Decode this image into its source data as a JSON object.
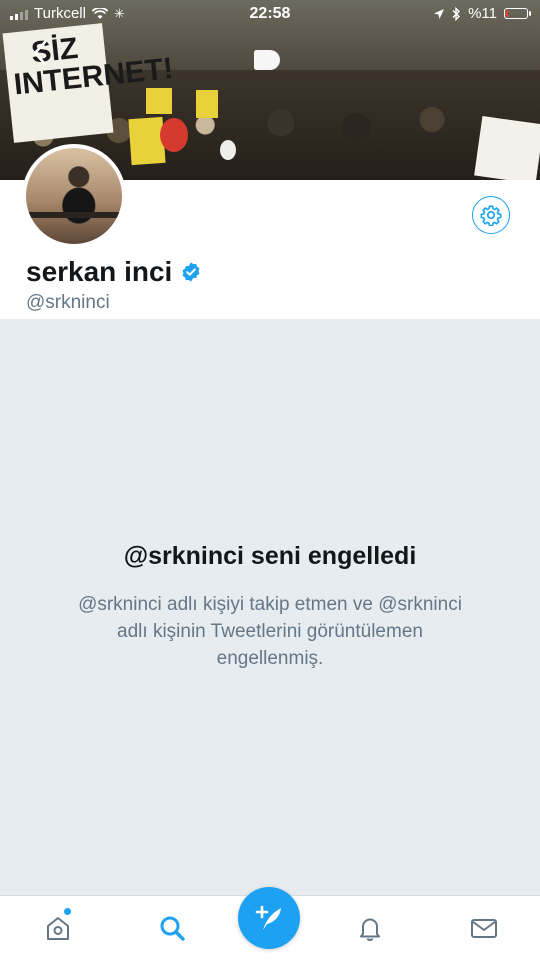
{
  "status_bar": {
    "carrier": "Turkcell",
    "time": "22:58",
    "battery": "%11",
    "battery_level": 0.11
  },
  "banner": {
    "sign_text": "SİZ INTERNET!"
  },
  "profile": {
    "name": "serkan inci",
    "handle": "@srkninci",
    "verified": true
  },
  "blocked": {
    "title": "@srkninci seni engelledi",
    "description": "@srkninci adlı kişiyi takip etmen ve @srkninci adlı kişinin Tweetlerini görüntülemen engellenmiş."
  },
  "tabs": [
    {
      "icon": "home-icon",
      "has_notification_dot": true
    },
    {
      "icon": "search-icon",
      "active": true
    },
    {
      "icon": "bell-icon"
    },
    {
      "icon": "mail-icon"
    }
  ],
  "compose": {
    "icon": "compose-tweet-icon"
  },
  "colors": {
    "accent": "#1da1f2",
    "text_primary": "#14171a",
    "text_secondary": "#657786",
    "background": "#e6ecf0"
  }
}
